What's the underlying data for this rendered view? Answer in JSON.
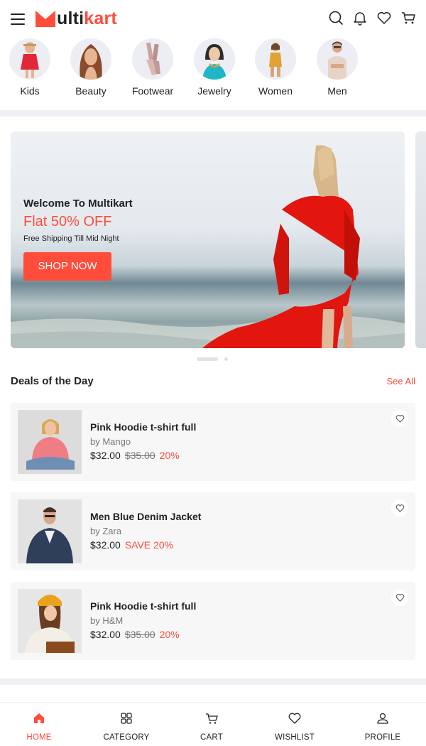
{
  "header": {
    "logo_prefix": "ulti",
    "logo_suffix": "kart",
    "brand_color": "#ff4c3b",
    "icons": [
      "menu-icon",
      "search-icon",
      "bell-icon",
      "heart-icon",
      "cart-icon"
    ]
  },
  "categories": [
    {
      "label": "Kids",
      "icon": "kids-avatar"
    },
    {
      "label": "Beauty",
      "icon": "beauty-avatar"
    },
    {
      "label": "Footwear",
      "icon": "footwear-avatar"
    },
    {
      "label": "Jewelry",
      "icon": "jewelry-avatar"
    },
    {
      "label": "Women",
      "icon": "women-avatar"
    },
    {
      "label": "Men",
      "icon": "men-avatar"
    }
  ],
  "banner": {
    "welcome": "Welcome To Multikart",
    "offer": "Flat 50% OFF",
    "shipping": "Free Shipping Till Mid Night",
    "button": "SHOP NOW"
  },
  "deals": {
    "title": "Deals of the Day",
    "see_all": "See All",
    "products": [
      {
        "name": "Pink Hoodie t-shirt full",
        "brand": "by Mango",
        "price": "$32.00",
        "old_price": "$35.00",
        "discount": "20%"
      },
      {
        "name": "Men Blue Denim Jacket",
        "brand": "by Zara",
        "price": "$32.00",
        "old_price": "",
        "discount": "SAVE 20%"
      },
      {
        "name": "Pink Hoodie t-shirt full",
        "brand": "by H&M",
        "price": "$32.00",
        "old_price": "$35.00",
        "discount": "20%"
      }
    ]
  },
  "bottom_nav": {
    "items": [
      {
        "label": "HOME",
        "icon": "home-icon",
        "active": true
      },
      {
        "label": "CATEGORY",
        "icon": "category-icon",
        "active": false
      },
      {
        "label": "CART",
        "icon": "cart-icon",
        "active": false
      },
      {
        "label": "WISHLIST",
        "icon": "heart-icon",
        "active": false
      },
      {
        "label": "PROFILE",
        "icon": "profile-icon",
        "active": false
      }
    ]
  }
}
